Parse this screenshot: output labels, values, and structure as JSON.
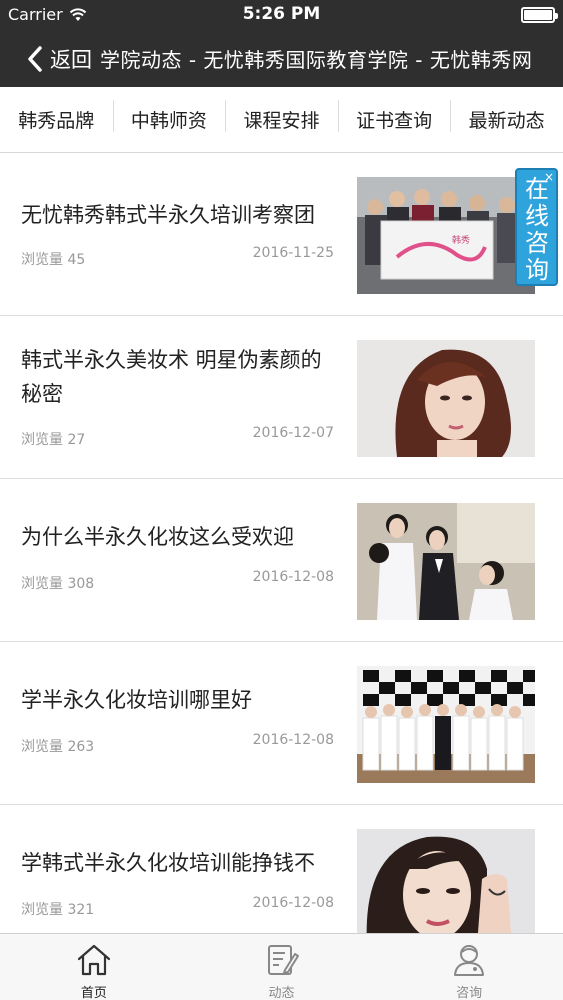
{
  "status_bar": {
    "carrier": "Carrier",
    "time": "5:26 PM"
  },
  "nav": {
    "back_label": "返回",
    "title": "学院动态 - 无忧韩秀国际教育学院 - 无忧韩秀网"
  },
  "tabs": [
    {
      "label": "韩秀品牌"
    },
    {
      "label": "中韩师资"
    },
    {
      "label": "课程安排"
    },
    {
      "label": "证书查询"
    },
    {
      "label": "最新动态"
    }
  ],
  "articles": [
    {
      "title": "无忧韩秀韩式半永久培训考察团",
      "views": "浏览量 45",
      "date": "2016-11-25"
    },
    {
      "title": "韩式半永久美妆术 明星伪素颜的秘密",
      "views": "浏览量 27",
      "date": "2016-12-07"
    },
    {
      "title": "为什么半永久化妆这么受欢迎",
      "views": "浏览量 308",
      "date": "2016-12-08"
    },
    {
      "title": "学半永久化妆培训哪里好",
      "views": "浏览量 263",
      "date": "2016-12-08"
    },
    {
      "title": "学韩式半永久化妆培训能挣钱不",
      "views": "浏览量 321",
      "date": "2016-12-08"
    }
  ],
  "float_consult": {
    "label": "在线咨询",
    "close": "×"
  },
  "tabbar": [
    {
      "label": "首页",
      "icon": "home-icon",
      "active": true
    },
    {
      "label": "动态",
      "icon": "news-edit-icon",
      "active": false
    },
    {
      "label": "咨询",
      "icon": "consult-person-icon",
      "active": false
    }
  ],
  "colors": {
    "nav_bg": "#2f2f2f",
    "float_bg": "#2fa3dc",
    "text_muted": "#999999"
  }
}
